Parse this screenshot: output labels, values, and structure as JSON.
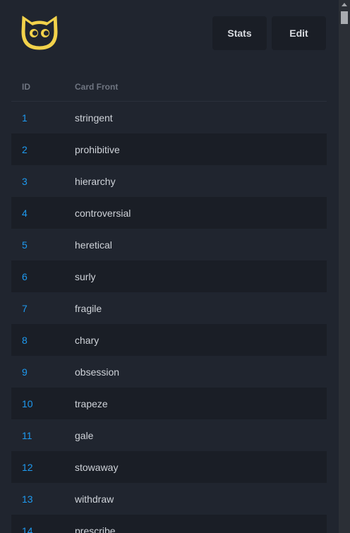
{
  "header": {
    "logo_icon": "cat-face-icon",
    "stats_label": "Stats",
    "edit_label": "Edit"
  },
  "table": {
    "columns": [
      "ID",
      "Card Front"
    ],
    "rows": [
      {
        "id": "1",
        "front": "stringent"
      },
      {
        "id": "2",
        "front": "prohibitive"
      },
      {
        "id": "3",
        "front": "hierarchy"
      },
      {
        "id": "4",
        "front": "controversial"
      },
      {
        "id": "5",
        "front": "heretical"
      },
      {
        "id": "6",
        "front": "surly"
      },
      {
        "id": "7",
        "front": "fragile"
      },
      {
        "id": "8",
        "front": "chary"
      },
      {
        "id": "9",
        "front": "obsession"
      },
      {
        "id": "10",
        "front": "trapeze"
      },
      {
        "id": "11",
        "front": "gale"
      },
      {
        "id": "12",
        "front": "stowaway"
      },
      {
        "id": "13",
        "front": "withdraw"
      },
      {
        "id": "14",
        "front": "prescribe"
      }
    ]
  },
  "colors": {
    "background": "#20252f",
    "row_alt": "#1a1e26",
    "link": "#1e9af0",
    "logo": "#f2d24b"
  }
}
